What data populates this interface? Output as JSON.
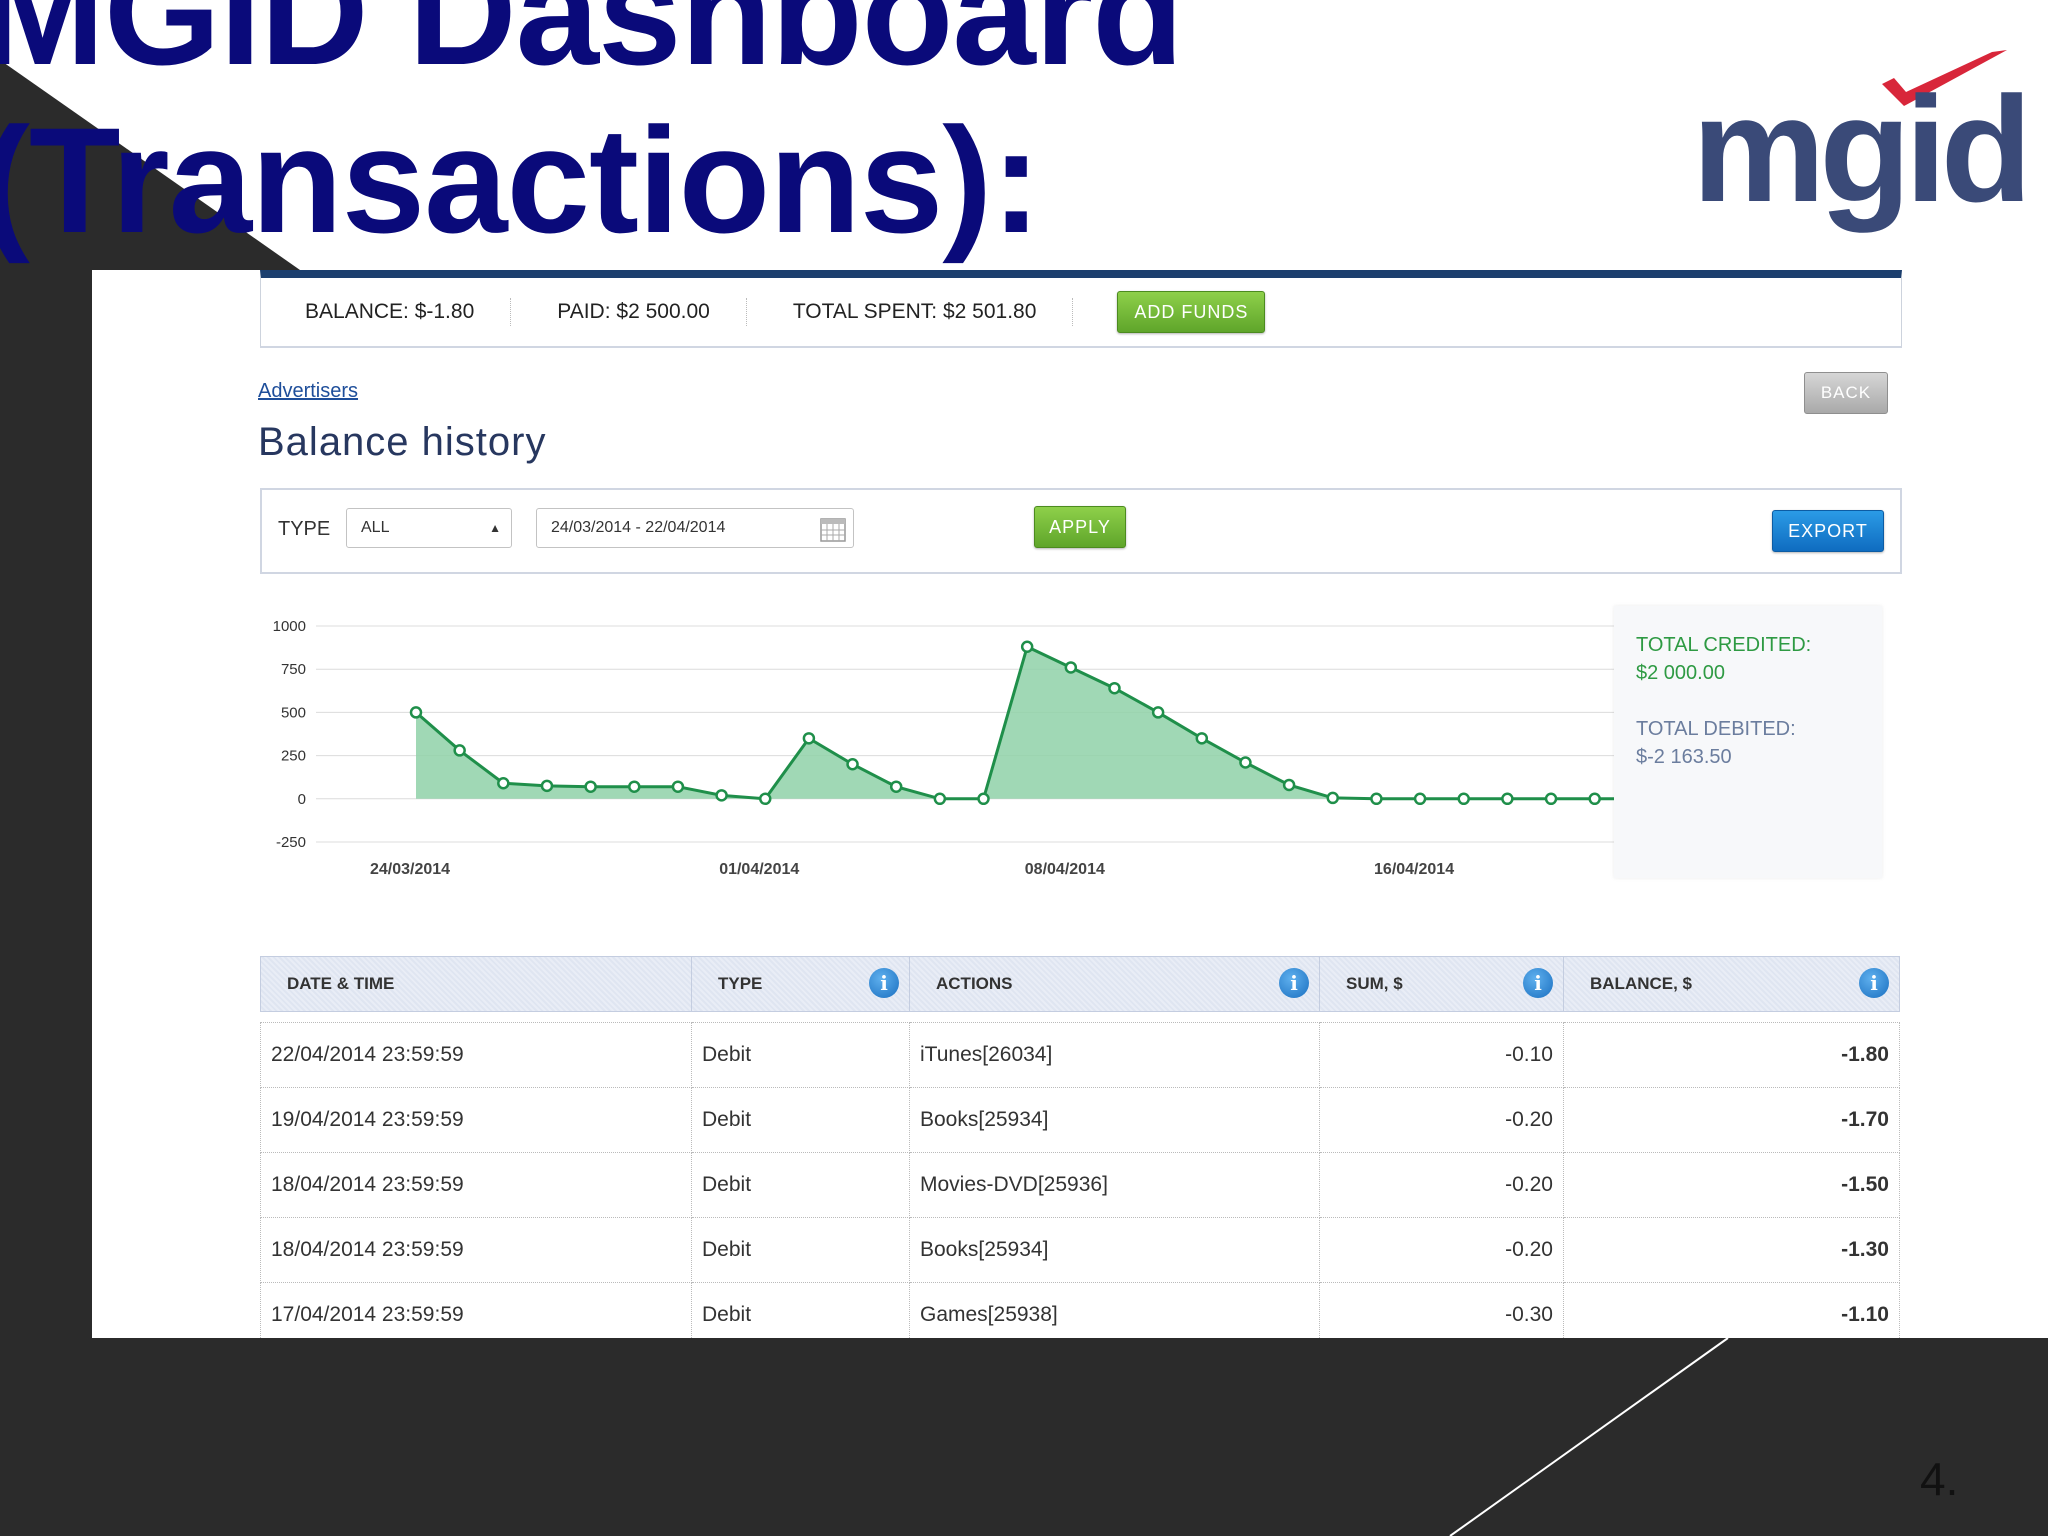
{
  "slide": {
    "title_line1": "MGID Dashboard",
    "title_line2": "(Transactions):",
    "logo_text": "mgid",
    "page_number": "4."
  },
  "topbar": {
    "balance": "BALANCE: $-1.80",
    "paid": "PAID: $2 500.00",
    "total_spent": "TOTAL SPENT: $2 501.80",
    "add_funds": "ADD FUNDS"
  },
  "nav": {
    "breadcrumb": "Advertisers",
    "back": "BACK",
    "heading": "Balance history"
  },
  "filters": {
    "type_label": "TYPE",
    "type_value": "ALL",
    "date_range": "24/03/2014 - 22/04/2014",
    "apply": "APPLY",
    "export": "EXPORT"
  },
  "totals": {
    "credited_label": "TOTAL CREDITED:",
    "credited_value": "$2 000.00",
    "debited_label": "TOTAL DEBITED:",
    "debited_value": "$-2 163.50"
  },
  "chart_data": {
    "type": "area",
    "color": "#1f8f4a",
    "fill": "#8fd1a8",
    "ylim": [
      -250,
      1000
    ],
    "yticks": [
      1000,
      750,
      500,
      250,
      0,
      -250
    ],
    "xtick_labels": [
      {
        "index": 0,
        "label": "24/03/2014"
      },
      {
        "index": 8,
        "label": "01/04/2014"
      },
      {
        "index": 15,
        "label": "08/04/2014"
      },
      {
        "index": 23,
        "label": "16/04/2014"
      }
    ],
    "values": [
      500,
      280,
      90,
      75,
      70,
      70,
      70,
      20,
      0,
      350,
      200,
      70,
      0,
      0,
      880,
      760,
      640,
      500,
      350,
      210,
      80,
      5,
      0,
      0,
      0,
      0,
      0,
      0,
      0,
      0
    ]
  },
  "table": {
    "headers": [
      "DATE & TIME",
      "TYPE",
      "ACTIONS",
      "SUM, $",
      "BALANCE, $"
    ],
    "rows": [
      [
        "22/04/2014 23:59:59",
        "Debit",
        "iTunes[26034]",
        "-0.10",
        "-1.80"
      ],
      [
        "19/04/2014 23:59:59",
        "Debit",
        "Books[25934]",
        "-0.20",
        "-1.70"
      ],
      [
        "18/04/2014 23:59:59",
        "Debit",
        "Movies-DVD[25936]",
        "-0.20",
        "-1.50"
      ],
      [
        "18/04/2014 23:59:59",
        "Debit",
        "Books[25934]",
        "-0.20",
        "-1.30"
      ],
      [
        "17/04/2014 23:59:59",
        "Debit",
        "Games[25938]",
        "-0.30",
        "-1.10"
      ]
    ]
  }
}
